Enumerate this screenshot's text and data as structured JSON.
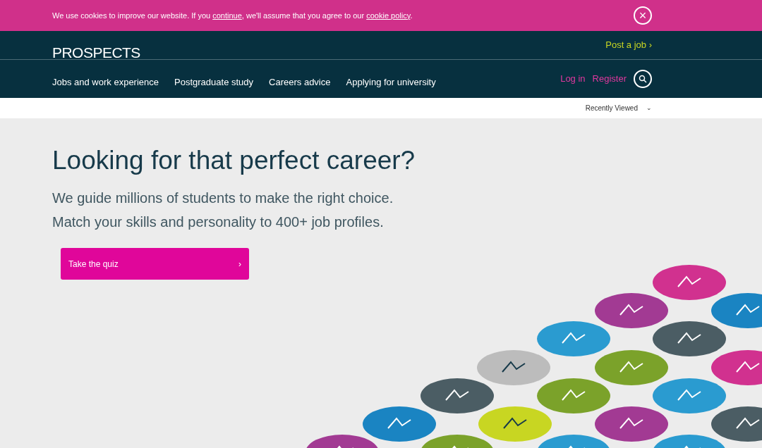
{
  "cookie_banner": {
    "segments": [
      {
        "kind": "text",
        "text": "We use cookies to improve our website. If you "
      },
      {
        "kind": "link",
        "text": "continue"
      },
      {
        "kind": "text",
        "text": ", we'll assume that you agree to our "
      },
      {
        "kind": "link",
        "text": "cookie policy"
      },
      {
        "kind": "text",
        "text": "."
      }
    ],
    "close": "×"
  },
  "header": {
    "logo": "PROSPECTS",
    "post_job": "Post a job ›",
    "nav": [
      "Jobs and work experience",
      "Postgraduate study",
      "Careers advice",
      "Applying for university"
    ],
    "login": "Log in",
    "register": "Register"
  },
  "recently_viewed": {
    "label": "Recently Viewed",
    "caret": "⌄"
  },
  "hero": {
    "title": "Looking for that perfect career?",
    "lines": [
      "We guide millions of students to make the right choice.",
      "Match your skills and personality to 400+ job profiles."
    ],
    "button": {
      "label": "Take the quiz",
      "arrow": "›"
    }
  }
}
